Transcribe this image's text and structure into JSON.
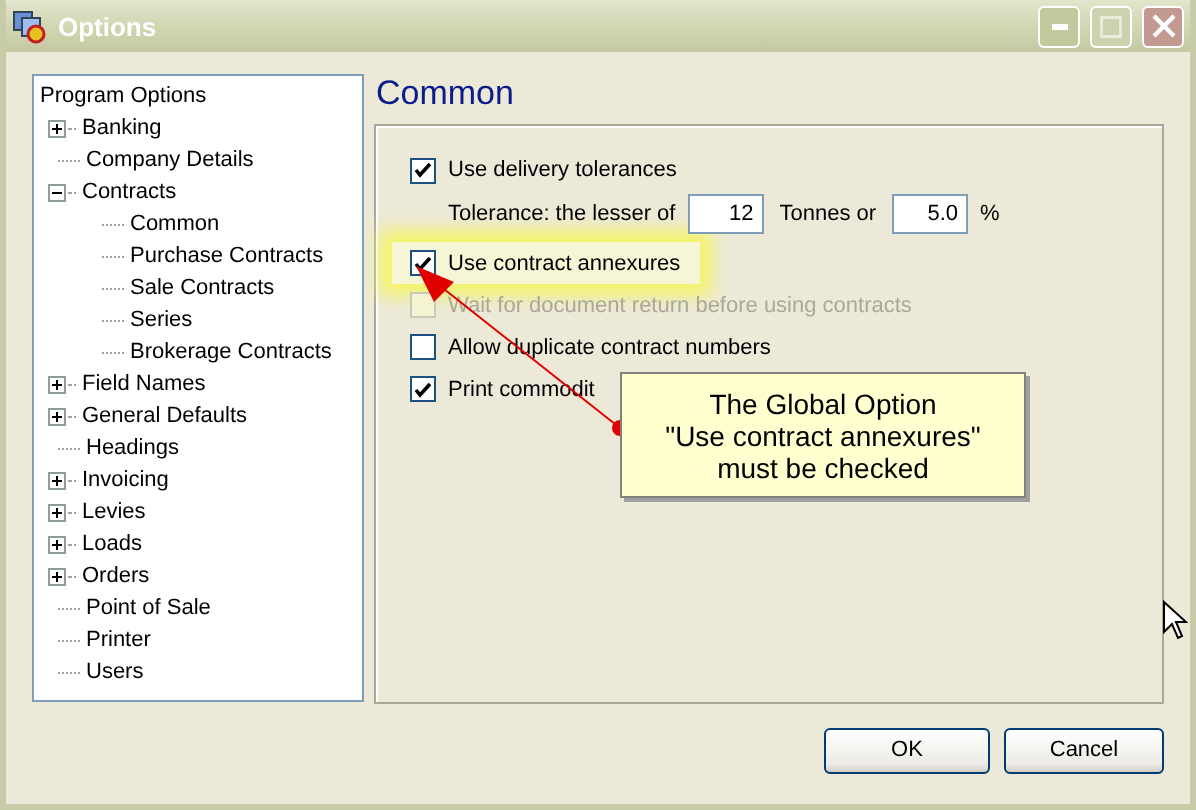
{
  "window": {
    "title": "Options"
  },
  "tree": {
    "root": "Program Options",
    "items": [
      {
        "label": "Banking",
        "kind": "branch",
        "expanded": false
      },
      {
        "label": "Company Details",
        "kind": "leaf"
      },
      {
        "label": "Contracts",
        "kind": "branch",
        "expanded": true,
        "children": [
          {
            "label": "Common"
          },
          {
            "label": "Purchase Contracts"
          },
          {
            "label": "Sale Contracts"
          },
          {
            "label": "Series"
          },
          {
            "label": "Brokerage Contracts"
          }
        ]
      },
      {
        "label": "Field Names",
        "kind": "branch",
        "expanded": false
      },
      {
        "label": "General Defaults",
        "kind": "branch",
        "expanded": false
      },
      {
        "label": "Headings",
        "kind": "leaf"
      },
      {
        "label": "Invoicing",
        "kind": "branch",
        "expanded": false
      },
      {
        "label": "Levies",
        "kind": "branch",
        "expanded": false
      },
      {
        "label": "Loads",
        "kind": "branch",
        "expanded": false
      },
      {
        "label": "Orders",
        "kind": "branch",
        "expanded": false
      },
      {
        "label": "Point of Sale",
        "kind": "leaf"
      },
      {
        "label": "Printer",
        "kind": "leaf"
      },
      {
        "label": "Users",
        "kind": "leaf"
      }
    ]
  },
  "page": {
    "heading": "Common",
    "options": [
      {
        "kind": "checkbox",
        "label": "Use delivery tolerances",
        "checked": true,
        "disabled": false,
        "highlighted": false
      },
      {
        "kind": "tolerance",
        "label": "Tolerance: the lesser of",
        "tonnes": "12",
        "tonnes_label": "Tonnes or",
        "percent": "5.0",
        "percent_label": "%"
      },
      {
        "kind": "checkbox",
        "label": "Use contract annexures",
        "checked": true,
        "disabled": false,
        "highlighted": true
      },
      {
        "kind": "checkbox",
        "label": "Wait for document return before using contracts",
        "checked": false,
        "disabled": true,
        "highlighted": false
      },
      {
        "kind": "checkbox",
        "label": "Allow duplicate contract numbers",
        "checked": false,
        "disabled": false,
        "highlighted": false
      },
      {
        "kind": "checkbox",
        "label": "Print commodit",
        "checked": true,
        "disabled": false,
        "highlighted": false
      }
    ]
  },
  "callout": {
    "lines": [
      "The Global Option",
      "\"Use contract annexures\"",
      "must be checked"
    ]
  },
  "buttons": [
    "OK",
    "Cancel"
  ]
}
